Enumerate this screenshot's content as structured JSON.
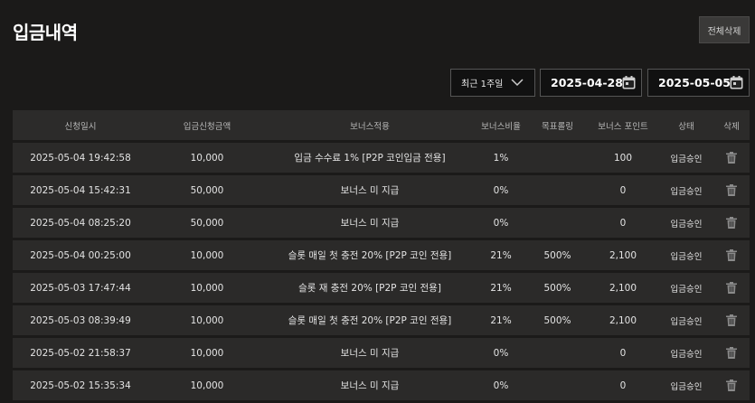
{
  "header": {
    "title": "입금내역",
    "delete_all_label": "전체삭제"
  },
  "filters": {
    "period_label": "최근 1주일",
    "start_date": "2025-04-28",
    "end_date": "2025-05-05"
  },
  "table": {
    "columns": [
      "신청일시",
      "입금신청금액",
      "보너스적용",
      "보너스비율",
      "목표롤링",
      "보너스 포인트",
      "상태",
      "삭제"
    ],
    "rows": [
      {
        "date": "2025-05-04 19:42:58",
        "amount": "10,000",
        "bonus": "입금 수수료 1% [P2P 코인입금 전용]",
        "rate": "1%",
        "target": "",
        "point": "100",
        "state": "입금승인"
      },
      {
        "date": "2025-05-04 15:42:31",
        "amount": "50,000",
        "bonus": "보너스 미 지급",
        "rate": "0%",
        "target": "",
        "point": "0",
        "state": "입금승인"
      },
      {
        "date": "2025-05-04 08:25:20",
        "amount": "50,000",
        "bonus": "보너스 미 지급",
        "rate": "0%",
        "target": "",
        "point": "0",
        "state": "입금승인"
      },
      {
        "date": "2025-05-04 00:25:00",
        "amount": "10,000",
        "bonus": "슬롯 매일 첫 충전 20% [P2P 코인 전용]",
        "rate": "21%",
        "target": "500%",
        "point": "2,100",
        "state": "입금승인"
      },
      {
        "date": "2025-05-03 17:47:44",
        "amount": "10,000",
        "bonus": "슬롯 재 충전 20% [P2P 코인 전용]",
        "rate": "21%",
        "target": "500%",
        "point": "2,100",
        "state": "입금승인"
      },
      {
        "date": "2025-05-03 08:39:49",
        "amount": "10,000",
        "bonus": "슬롯 매일 첫 충전 20% [P2P 코인 전용]",
        "rate": "21%",
        "target": "500%",
        "point": "2,100",
        "state": "입금승인"
      },
      {
        "date": "2025-05-02 21:58:37",
        "amount": "10,000",
        "bonus": "보너스 미 지급",
        "rate": "0%",
        "target": "",
        "point": "0",
        "state": "입금승인"
      },
      {
        "date": "2025-05-02 15:35:34",
        "amount": "10,000",
        "bonus": "보너스 미 지급",
        "rate": "0%",
        "target": "",
        "point": "0",
        "state": "입금승인"
      }
    ]
  },
  "icons": {
    "calendar": "calendar-icon",
    "trash": "trash-icon",
    "chevron": "chevron-down-icon"
  }
}
